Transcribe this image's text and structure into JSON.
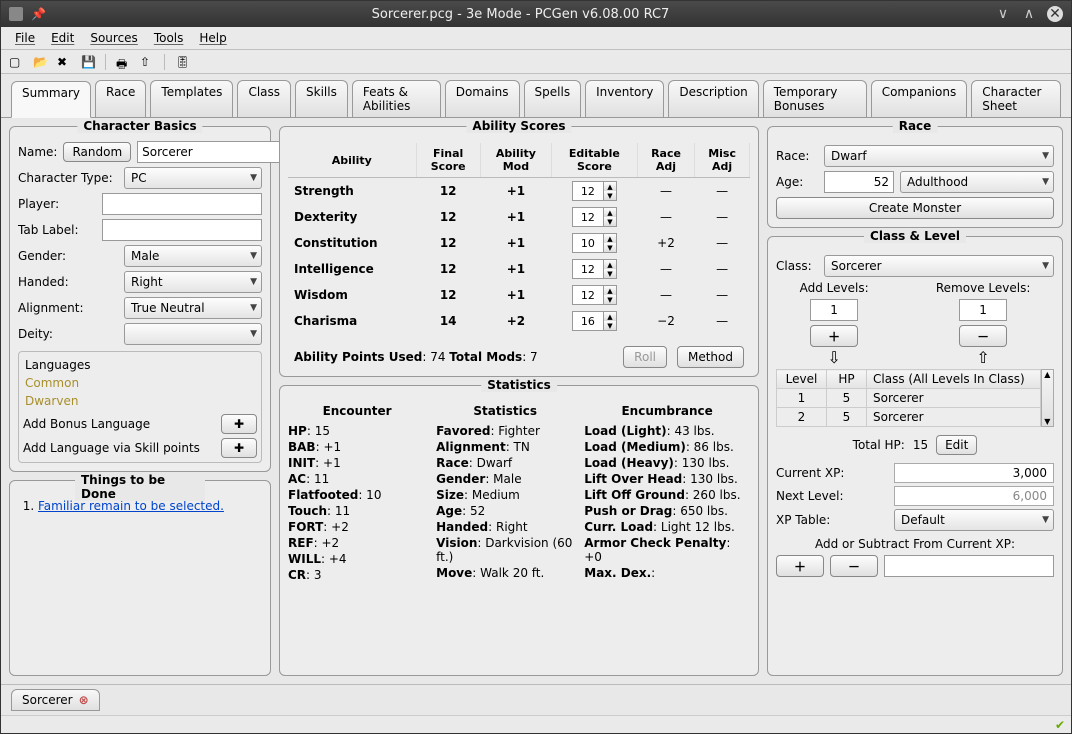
{
  "window": {
    "title": "Sorcerer.pcg - 3e Mode - PCGen v6.08.00 RC7"
  },
  "menu": [
    "File",
    "Edit",
    "Sources",
    "Tools",
    "Help"
  ],
  "mainTabs": [
    "Summary",
    "Race",
    "Templates",
    "Class",
    "Skills",
    "Feats & Abilities",
    "Domains",
    "Spells",
    "Inventory",
    "Description",
    "Temporary Bonuses",
    "Companions",
    "Character Sheet"
  ],
  "activeTab": 0,
  "basics": {
    "title": "Character Basics",
    "nameLabel": "Name:",
    "random": "Random",
    "nameValue": "Sorcerer",
    "charTypeLabel": "Character Type:",
    "charTypeValue": "PC",
    "playerLabel": "Player:",
    "playerValue": "",
    "tabLabelLabel": "Tab Label:",
    "tabLabelValue": "",
    "genderLabel": "Gender:",
    "genderValue": "Male",
    "handedLabel": "Handed:",
    "handedValue": "Right",
    "alignmentLabel": "Alignment:",
    "alignmentValue": "True Neutral",
    "deityLabel": "Deity:",
    "deityValue": "",
    "langHeader": "Languages",
    "langs": [
      "Common",
      "Dwarven"
    ],
    "addBonusLang": "Add Bonus Language",
    "addLangSkill": "Add Language via Skill points",
    "plusIcon": "✚"
  },
  "todo": {
    "title": "Things to be Done",
    "item": "Familiar remain to be selected."
  },
  "abilities": {
    "title": "Ability Scores",
    "headers": [
      "Ability",
      "Final Score",
      "Ability Mod",
      "Editable Score",
      "Race Adj",
      "Misc Adj"
    ],
    "rows": [
      {
        "name": "Strength",
        "final": "12",
        "mod": "+1",
        "edit": "12",
        "race": "—",
        "misc": "—"
      },
      {
        "name": "Dexterity",
        "final": "12",
        "mod": "+1",
        "edit": "12",
        "race": "—",
        "misc": "—"
      },
      {
        "name": "Constitution",
        "final": "12",
        "mod": "+1",
        "edit": "10",
        "race": "+2",
        "misc": "—"
      },
      {
        "name": "Intelligence",
        "final": "12",
        "mod": "+1",
        "edit": "12",
        "race": "—",
        "misc": "—"
      },
      {
        "name": "Wisdom",
        "final": "12",
        "mod": "+1",
        "edit": "12",
        "race": "—",
        "misc": "—"
      },
      {
        "name": "Charisma",
        "final": "14",
        "mod": "+2",
        "edit": "16",
        "race": "−2",
        "misc": "—"
      }
    ],
    "pointsLabel": "Ability Points Used",
    "pointsVal": "74",
    "modsLabel": "Total Mods",
    "modsVal": "7",
    "rollBtn": "Roll",
    "methodBtn": "Method"
  },
  "stats": {
    "title": "Statistics",
    "encounter": {
      "hdr": "Encounter",
      "rows": [
        [
          "HP",
          "15"
        ],
        [
          "BAB",
          "+1"
        ],
        [
          "INIT",
          "+1"
        ],
        [
          "AC",
          "11"
        ],
        [
          "Flatfooted",
          "10"
        ],
        [
          "Touch",
          "11"
        ],
        [
          "FORT",
          "+2"
        ],
        [
          "REF",
          "+2"
        ],
        [
          "WILL",
          "+4"
        ],
        [
          "CR",
          "3"
        ]
      ]
    },
    "statistics": {
      "hdr": "Statistics",
      "rows": [
        [
          "Favored",
          "Fighter"
        ],
        [
          "Alignment",
          "TN"
        ],
        [
          "Race",
          "Dwarf"
        ],
        [
          "Gender",
          "Male"
        ],
        [
          "Size",
          "Medium"
        ],
        [
          "Age",
          "52"
        ],
        [
          "Handed",
          "Right"
        ],
        [
          "Vision",
          "Darkvision (60 ft.)"
        ],
        [
          "Move",
          "Walk 20 ft."
        ]
      ]
    },
    "encumbrance": {
      "hdr": "Encumbrance",
      "rows": [
        [
          "Load (Light)",
          "43 lbs."
        ],
        [
          "Load (Medium)",
          "86 lbs."
        ],
        [
          "Load (Heavy)",
          "130 lbs."
        ],
        [
          "Lift Over Head",
          "130 lbs."
        ],
        [
          "Lift Off Ground",
          "260 lbs."
        ],
        [
          "Push or Drag",
          "650 lbs."
        ],
        [
          "Curr. Load",
          "Light 12 lbs."
        ],
        [
          "Armor Check Penalty",
          "+0"
        ],
        [
          "Max. Dex.",
          ""
        ]
      ]
    }
  },
  "race": {
    "title": "Race",
    "raceLabel": "Race:",
    "raceValue": "Dwarf",
    "ageLabel": "Age:",
    "ageValue": "52",
    "ageCat": "Adulthood",
    "createMonster": "Create Monster"
  },
  "classLevel": {
    "title": "Class & Level",
    "classLabel": "Class:",
    "classValue": "Sorcerer",
    "addLevels": "Add Levels:",
    "removeLevels": "Remove Levels:",
    "addVal": "1",
    "removeVal": "1",
    "tableHeaders": [
      "Level",
      "HP",
      "Class (All Levels In Class)"
    ],
    "tableRows": [
      [
        "1",
        "5",
        "Sorcerer"
      ],
      [
        "2",
        "5",
        "Sorcerer"
      ]
    ],
    "totalHpLabel": "Total HP:",
    "totalHpVal": "15",
    "editBtn": "Edit",
    "currentXpLabel": "Current XP:",
    "currentXpVal": "3,000",
    "nextLevelLabel": "Next Level:",
    "nextLevelVal": "6,000",
    "xpTableLabel": "XP Table:",
    "xpTableVal": "Default",
    "addSubXpLabel": "Add or Subtract From Current XP:"
  },
  "bottomTab": "Sorcerer"
}
